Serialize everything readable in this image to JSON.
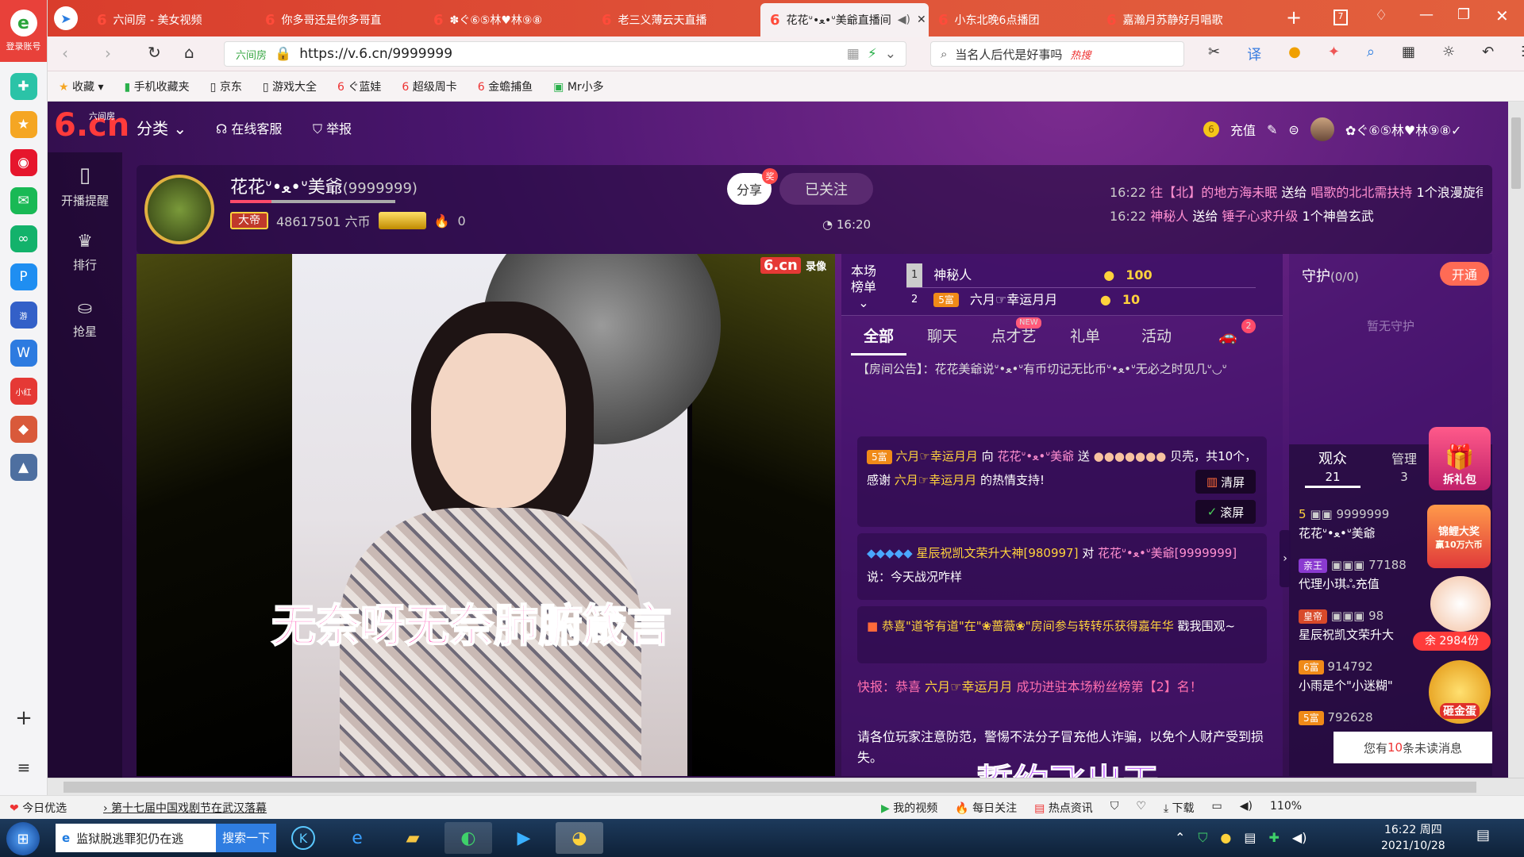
{
  "browser": {
    "login_label": "登录账号",
    "tabs": [
      {
        "title": "六间房 - 美女视频",
        "active": false
      },
      {
        "title": "你多哥还是你多哥直",
        "active": false
      },
      {
        "title": "✽ぐ⑥⑤林♥林⑨⑧",
        "active": false
      },
      {
        "title": "老三义薄云天直播",
        "active": false
      },
      {
        "title": "花花ᐡ•ﻌ•ᐡ美爺直播间",
        "active": true
      },
      {
        "title": "小东北晚6点播团",
        "active": false
      },
      {
        "title": "嘉瀚月苏静好月唱歌",
        "active": false
      }
    ],
    "url": "https://v.6.cn/9999999",
    "url_prefix": "六间房",
    "search_text": "当名人后代是好事吗",
    "search_badge": "热搜",
    "bookmarks": [
      "收藏",
      "手机收藏夹",
      "京东",
      "游戏大全",
      "ぐ蓝娃",
      "超级周卡",
      "金蟾捕鱼",
      "Mr小多"
    ]
  },
  "site": {
    "logo": "6.cn",
    "logo_sub": "六间房",
    "nav": {
      "category": "分类",
      "support": "在线客服",
      "report": "举报"
    },
    "user": {
      "recharge": "充值",
      "username": "✿ぐ⑥⑤林♥林⑨⑧✓"
    },
    "sidenav": [
      "开播提醒",
      "排行",
      "抢星"
    ],
    "anchor": {
      "name": "花花ᐡ•ﻌ•ᐡ美爺",
      "room_id": "(9999999)",
      "level_badge": "大帝",
      "coins": "48617501 六币",
      "fire_count": "0",
      "share": "分享",
      "share_badge": "奖",
      "follow": "已关注",
      "time": "16:20"
    },
    "gift_feed": [
      {
        "time": "16:22",
        "from": "往【北】的地方海未眠",
        "action": "送给",
        "to": "唱歌的北北需扶持",
        "gift": "1个浪漫旋律"
      },
      {
        "time": "16:22",
        "from": "神秘人",
        "action": "送给",
        "to": "锤子心求升级",
        "gift": "1个神兽玄武"
      }
    ],
    "video": {
      "watermark": "6.cn",
      "watermark_sub": "录像",
      "subtitle": "无奈呀无奈肺腑箴言",
      "bottom_text": "誓约飞出天"
    },
    "rank": {
      "title_line1": "本场",
      "title_line2": "榜单",
      "rows": [
        {
          "rank": "1",
          "name": "神秘人",
          "badge": "",
          "score": "100"
        },
        {
          "rank": "2",
          "name": "六月☞幸运月月",
          "badge": "5富",
          "score": "10"
        }
      ]
    },
    "chat_tabs": [
      "全部",
      "聊天",
      "点才艺",
      "礼单",
      "活动"
    ],
    "chat_tab_new": "NEW",
    "car_badge": "2",
    "announcement": "【房间公告】：花花美爺说ᐡ•ﻌ•ᐡ有币切记无比币ᐡ•ﻌ•ᐡ无必之时见几ᐡ◡ᐡ",
    "messages": [
      {
        "badge": "5富",
        "user": "六月☞幸运月月",
        "action": "向",
        "target": "花花ᐡ•ﻌ•ᐡ美爺",
        "text": "送",
        "detail": "贝壳，共10个，感谢",
        "detail_user": "六月☞幸运月月",
        "tail": "的热情支持!"
      },
      {
        "user": "星辰祝凯文荣升大神[980997]",
        "action": "对",
        "target": "花花ᐡ•ﻌ•ᐡ美爺[9999999]",
        "text": "说：今天战况咋样"
      },
      {
        "text": "恭喜\"道爷有道\"在\"❀蔷薇❀\"房间参与转转乐获得嘉年华",
        "tail": "戳我围观~"
      }
    ],
    "flash": {
      "label": "快报：恭喜",
      "user": "六月☞幸运月月",
      "text": "成功进驻本场粉丝榜第【2】名！"
    },
    "notice": "请各位玩家注意防范，警惕不法分子冒充他人诈骗，以免个人财产受到损失。",
    "chat_actions": {
      "clear": "清屏",
      "scroll": "滚屏"
    },
    "guard": {
      "title": "守护",
      "count": "(0/0)",
      "open": "开通",
      "empty": "暂无守护"
    },
    "audience": {
      "label": "观众",
      "count": "21",
      "admin_label": "管理",
      "admin_count": "3"
    },
    "viewers": [
      {
        "level": "5",
        "id": "9999999",
        "name": "花花ᐡ•ﻌ•ᐡ美爺"
      },
      {
        "level": "亲王",
        "id": "77188",
        "name": "代理小琪ஃ充值"
      },
      {
        "level": "皇帝",
        "id": "98",
        "name": "星辰祝凯文荣升大"
      },
      {
        "level": "6富",
        "id": "914792",
        "name": "小雨是个\"小迷糊\""
      },
      {
        "level": "5富",
        "id": "792628",
        "name": ""
      }
    ],
    "promos": {
      "gift": "拆礼包",
      "koi": "锦鲤大奖",
      "koi_sub": "赢10万六币",
      "remain": "余 2984份",
      "egg": "砸金蛋"
    },
    "unread": {
      "prefix": "您有",
      "count": "10",
      "suffix": "条未读消息"
    }
  },
  "statusbar": {
    "today": "今日优选",
    "news": "第十七届中国戏剧节在武汉落幕",
    "my_video": "我的视频",
    "daily": "每日关注",
    "hot": "热点资讯",
    "download": "下载",
    "zoom": "110%"
  },
  "taskbar": {
    "ie_news": "监狱脱逃罪犯仍在逃",
    "search_btn": "搜索一下",
    "time": "16:22 周四",
    "date": "2021/10/28"
  }
}
